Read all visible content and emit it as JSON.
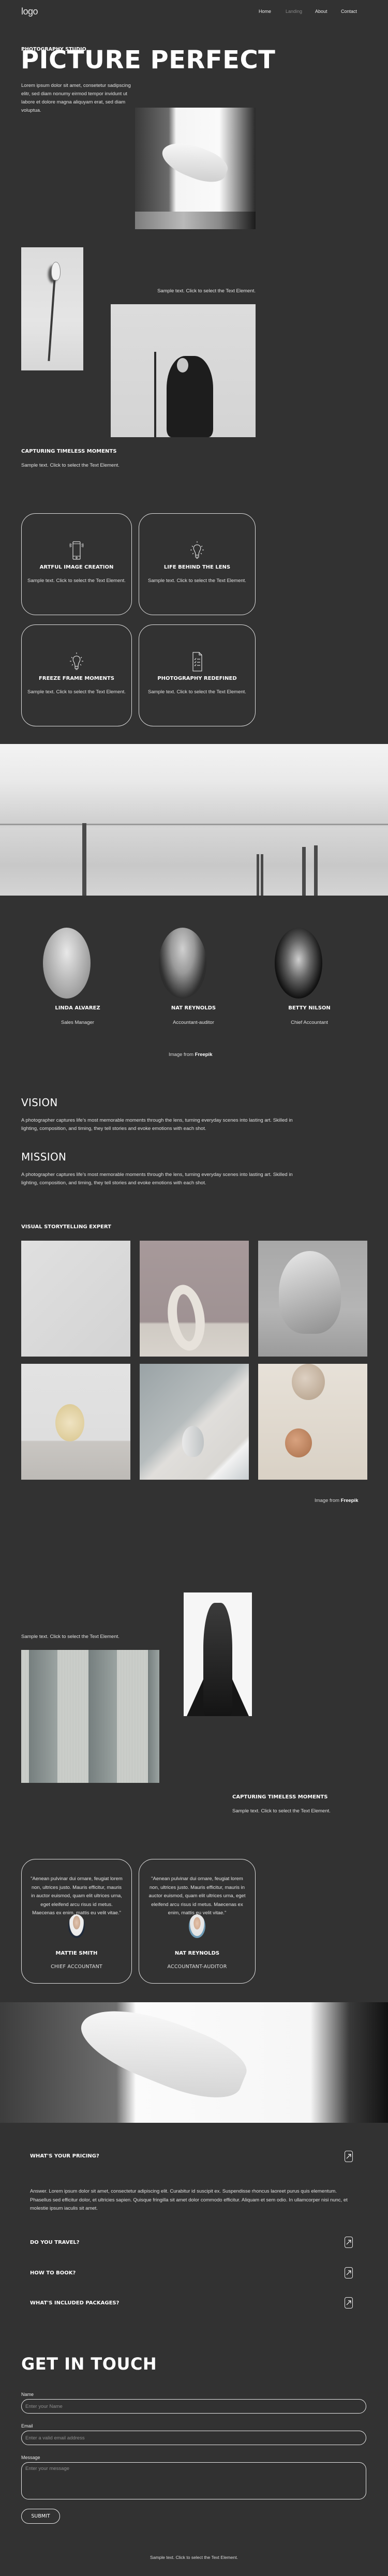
{
  "nav": {
    "logo": "logo",
    "items": [
      {
        "label": "Home",
        "active": false
      },
      {
        "label": "Landing",
        "active": true
      },
      {
        "label": "About",
        "active": false
      },
      {
        "label": "Contact",
        "active": false
      }
    ]
  },
  "hero": {
    "kicker": "PHOTOGRAPHY STUDIO",
    "title": "PICTURE PERFECT",
    "paragraph": "Lorem ipsum dolor sit amet, consetetur sadipscing elitr, sed diam nonumy eirmod tempor invidunt ut labore et dolore magna aliquyam erat, sed diam voluptua."
  },
  "intro": {
    "sample_right": "Sample text. Click to select the Text Element.",
    "title": "CAPTURING TIMELESS MOMENTS",
    "sample": "Sample text. Click to select the Text Element."
  },
  "features": [
    {
      "icon": "smartphone-icon",
      "title": "ARTFUL IMAGE CREATION",
      "text": "Sample text. Click to select the Text Element."
    },
    {
      "icon": "lightbulb-icon",
      "title": "LIFE BEHIND THE LENS",
      "text": "Sample text. Click to select the Text Element."
    },
    {
      "icon": "lightbulb-icon",
      "title": "FREEZE FRAME MOMENTS",
      "text": "Sample text. Click to select the Text Element."
    },
    {
      "icon": "checklist-document-icon",
      "title": "PHOTOGRAPHY REDEFINED",
      "text": "Sample text. Click to select the Text Element."
    }
  ],
  "team": {
    "members": [
      {
        "name": "LINDA ALVAREZ",
        "role": "Sales Manager"
      },
      {
        "name": "NAT REYNOLDS",
        "role": "Accountant-auditor"
      },
      {
        "name": "BETTY NILSON",
        "role": "Chief Accountant"
      }
    ],
    "credit_prefix": "Image from",
    "credit_source": "Freepik"
  },
  "about": {
    "vision_title": "VISION",
    "vision_text": "A photographer captures life’s most memorable moments through the lens, turning everyday scenes into lasting art. Skilled in lighting, composition, and timing, they tell stories and evoke emotions with each shot.",
    "mission_title": "MISSION",
    "mission_text": "A photographer captures life’s most memorable moments through the lens, turning everyday scenes into lasting art. Skilled in lighting, composition, and timing, they tell stories and evoke emotions with each shot."
  },
  "gallery": {
    "title": "VISUAL STORYTELLING EXPERT",
    "images": [
      "shadow-lines",
      "ring-vase-with-eucalyptus",
      "wrapped-face-sculpture",
      "wooden-disc-with-leaves",
      "white-vase",
      "wooden-spheres-with-fabric"
    ],
    "credit_prefix": "Image from",
    "credit_source": "Freepik"
  },
  "story": {
    "sample_top": "Sample text. Click to select the Text Element.",
    "title": "CAPTURING TIMELESS MOMENTS",
    "sample": "Sample text. Click to select the Text Element."
  },
  "testimonials": [
    {
      "quote": "\"Aenean pulvinar dui ornare, feugiat lorem non, ultrices justo. Mauris efficitur, mauris in auctor euismod, quam elit ultrices urna, eget eleifend arcu risus id metus. Maecenas ex enim, mattis eu velit vitae.\"",
      "name": "MATTIE SMITH",
      "role": "CHIEF ACCOUNTANT"
    },
    {
      "quote": "\"Aenean pulvinar dui ornare, feugiat lorem non, ultrices justo. Mauris efficitur, mauris in auctor euismod, quam elit ultrices urna, eget eleifend arcu risus id metus. Maecenas ex enim, mattis eu velit vitae.\"",
      "name": "NAT REYNOLDS",
      "role": "ACCOUNTANT-AUDITOR"
    }
  ],
  "faq": {
    "items": [
      {
        "question": "WHAT'S YOUR PRICING?",
        "expanded": true
      },
      {
        "question": "DO YOU TRAVEL?",
        "expanded": false
      },
      {
        "question": "HOW TO BOOK?",
        "expanded": false
      },
      {
        "question": "WHAT'S INCLUDED PACKAGES?",
        "expanded": false
      }
    ],
    "answer": "Answer. Lorem ipsum dolor sit amet, consectetur adipiscing elit. Curabitur id suscipit ex. Suspendisse rhoncus laoreet purus quis elementum. Phasellus sed efficitur dolor, et ultricies sapien. Quisque fringilla sit amet dolor commodo efficitur. Aliquam et sem odio. In ullamcorper nisi nunc, et molestie ipsum iaculis sit amet."
  },
  "contact": {
    "title": "GET IN TOUCH",
    "name_label": "Name",
    "name_placeholder": "Enter your Name",
    "name_value": "",
    "email_label": "Email",
    "email_placeholder": "Enter a valid email address",
    "email_value": "",
    "message_label": "Message",
    "message_placeholder": "Enter your message",
    "message_value": "",
    "submit_label": "SUBMIT"
  },
  "footer": {
    "text": "Sample text. Click to select the Text Element."
  }
}
